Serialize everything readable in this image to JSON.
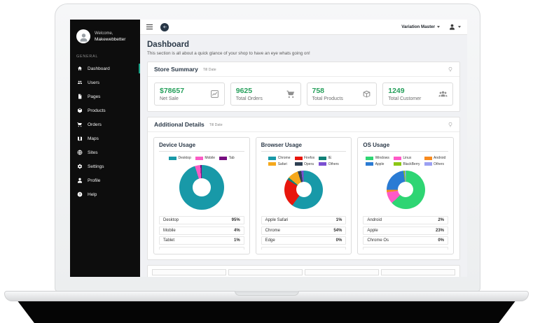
{
  "topbar": {
    "menu_label": "Variation Master"
  },
  "sidebar": {
    "welcome": "Welcome,",
    "username": "Makewebbetter",
    "section": "GENERAL",
    "items": [
      {
        "label": "Dashboard",
        "icon": "home",
        "active": true
      },
      {
        "label": "Users",
        "icon": "users"
      },
      {
        "label": "Pages",
        "icon": "pages"
      },
      {
        "label": "Products",
        "icon": "box"
      },
      {
        "label": "Orders",
        "icon": "cart"
      },
      {
        "label": "Maps",
        "icon": "map"
      },
      {
        "label": "Sites",
        "icon": "globe"
      },
      {
        "label": "Settings",
        "icon": "gear"
      },
      {
        "label": "Profile",
        "icon": "person"
      },
      {
        "label": "Help",
        "icon": "question"
      }
    ]
  },
  "page": {
    "title": "Dashboard",
    "subtitle": "This section is all about a quick glance of your shop to have an eye whats going on!"
  },
  "store_summary": {
    "title": "Store Summary",
    "till_date": "Till Date",
    "stats": [
      {
        "value": "$78657",
        "label": "Net Sale",
        "icon": "chart-line"
      },
      {
        "value": "9625",
        "label": "Total Orders",
        "icon": "cart"
      },
      {
        "value": "758",
        "label": "Total Products",
        "icon": "box"
      },
      {
        "value": "1249",
        "label": "Total Customer",
        "icon": "people-group"
      }
    ],
    "accent_color": "#27a05c"
  },
  "additional_details": {
    "title": "Additional Details",
    "till_date": "Till Date",
    "cards": [
      {
        "title": "Device Usage",
        "legend": [
          {
            "label": "Desktop",
            "color": "#1899a8"
          },
          {
            "label": "Mobile",
            "color": "#fa5bc4"
          },
          {
            "label": "Tab",
            "color": "#770d80"
          }
        ],
        "donut": [
          {
            "label": "Desktop",
            "color": "#1899a8",
            "value": 95
          },
          {
            "label": "Mobile",
            "color": "#fa5bc4",
            "value": 4
          },
          {
            "label": "Tab",
            "color": "#770d80",
            "value": 1
          }
        ],
        "table": [
          {
            "label": "Desktop",
            "value": "95%"
          },
          {
            "label": "Mobile",
            "value": "4%"
          },
          {
            "label": "Tablet",
            "value": "1%"
          }
        ]
      },
      {
        "title": "Browser Usage",
        "legend": [
          {
            "label": "Chrome",
            "color": "#1899a8"
          },
          {
            "label": "Firefox",
            "color": "#e8160c"
          },
          {
            "label": "IE",
            "color": "#0f8077"
          },
          {
            "label": "Safari",
            "color": "#f5a81c"
          },
          {
            "label": "Opera",
            "color": "#2e4053"
          },
          {
            "label": "Others",
            "color": "#7a4fd1"
          }
        ],
        "donut": [
          {
            "label": "Chrome",
            "color": "#1899a8",
            "value": 60
          },
          {
            "label": "Firefox",
            "color": "#e8160c",
            "value": 24
          },
          {
            "label": "IE",
            "color": "#0f8077",
            "value": 2
          },
          {
            "label": "Safari",
            "color": "#f5a81c",
            "value": 9
          },
          {
            "label": "Opera",
            "color": "#2e4053",
            "value": 3
          },
          {
            "label": "Others",
            "color": "#7a4fd1",
            "value": 2
          }
        ],
        "table": [
          {
            "label": "Apple Safari",
            "value": "1%"
          },
          {
            "label": "Chrome",
            "value": "54%"
          },
          {
            "label": "Edge",
            "value": "0%"
          }
        ]
      },
      {
        "title": "OS Usage",
        "legend": [
          {
            "label": "Windows",
            "color": "#2ed573"
          },
          {
            "label": "Linux",
            "color": "#ff59c7"
          },
          {
            "label": "Android",
            "color": "#f78a1e"
          },
          {
            "label": "Apple",
            "color": "#2a7bd4"
          },
          {
            "label": "BlackBerry",
            "color": "#8cc714"
          },
          {
            "label": "Others",
            "color": "#9ba0f2"
          }
        ],
        "donut": [
          {
            "label": "Windows",
            "color": "#2ed573",
            "value": 63
          },
          {
            "label": "Linux",
            "color": "#ff59c7",
            "value": 10
          },
          {
            "label": "Android",
            "color": "#f78a1e",
            "value": 2
          },
          {
            "label": "Apple",
            "color": "#2a7bd4",
            "value": 23
          },
          {
            "label": "BlackBerry",
            "color": "#8cc714",
            "value": 1
          },
          {
            "label": "Others",
            "color": "#9ba0f2",
            "value": 1
          }
        ],
        "table": [
          {
            "label": "Android",
            "value": "2%"
          },
          {
            "label": "Apple",
            "value": "23%"
          },
          {
            "label": "Chrome Os",
            "value": "0%"
          }
        ]
      }
    ]
  },
  "chart_data": [
    {
      "type": "pie",
      "title": "Device Usage",
      "labels": [
        "Desktop",
        "Mobile",
        "Tab"
      ],
      "values": [
        95,
        4,
        1
      ],
      "colors": [
        "#1899a8",
        "#fa5bc4",
        "#770d80"
      ],
      "legend_position": "top"
    },
    {
      "type": "pie",
      "title": "Browser Usage",
      "labels": [
        "Chrome",
        "Firefox",
        "IE",
        "Safari",
        "Opera",
        "Others"
      ],
      "values": [
        60,
        24,
        2,
        9,
        3,
        2
      ],
      "colors": [
        "#1899a8",
        "#e8160c",
        "#0f8077",
        "#f5a81c",
        "#2e4053",
        "#7a4fd1"
      ],
      "legend_position": "top"
    },
    {
      "type": "pie",
      "title": "OS Usage",
      "labels": [
        "Windows",
        "Linux",
        "Android",
        "Apple",
        "BlackBerry",
        "Others"
      ],
      "values": [
        63,
        10,
        2,
        23,
        1,
        1
      ],
      "colors": [
        "#2ed573",
        "#ff59c7",
        "#f78a1e",
        "#2a7bd4",
        "#8cc714",
        "#9ba0f2"
      ],
      "legend_position": "top"
    }
  ]
}
